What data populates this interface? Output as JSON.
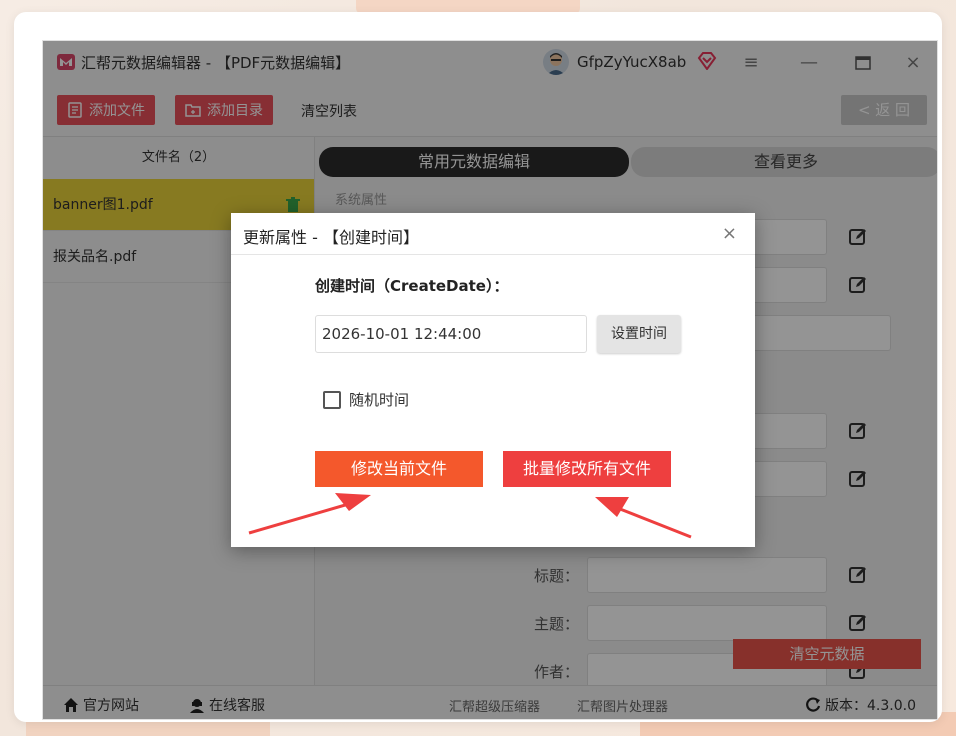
{
  "app": {
    "title": "汇帮元数据编辑器 - 【PDF元数据编辑】",
    "username": "GfpZyYucX8ab",
    "brand_color": "#e8505b"
  },
  "toolbar": {
    "add_file": "添加文件",
    "add_folder": "添加目录",
    "clear_list": "清空列表",
    "back": "< 返 回"
  },
  "sidebar": {
    "header": "文件名（2）",
    "files": [
      {
        "name": "banner图1.pdf",
        "selected": true
      },
      {
        "name": "报关品名.pdf",
        "selected": false
      }
    ]
  },
  "main": {
    "tab_common": "常用元数据编辑",
    "tab_more": "查看更多",
    "section_system": "系统属性",
    "label_title": "标题：",
    "label_subject": "主题：",
    "label_author": "作者：",
    "clear_metadata": "清空元数据"
  },
  "statusbar": {
    "website": "官方网站",
    "support": "在线客服",
    "link1": "汇帮超级压缩器",
    "link2": "汇帮图片处理器",
    "version": "版本：4.3.0.0"
  },
  "dialog": {
    "title": "更新属性 - 【创建时间】",
    "close": "×",
    "field_label": "创建时间（CreateDate）：",
    "value": "2026-10-01 12:44:00",
    "set_time": "设置时间",
    "random_time": "随机时间",
    "random_checked": false,
    "modify_current": "修改当前文件",
    "modify_all": "批量修改所有文件",
    "arrow_color": "#ee3f3f"
  }
}
